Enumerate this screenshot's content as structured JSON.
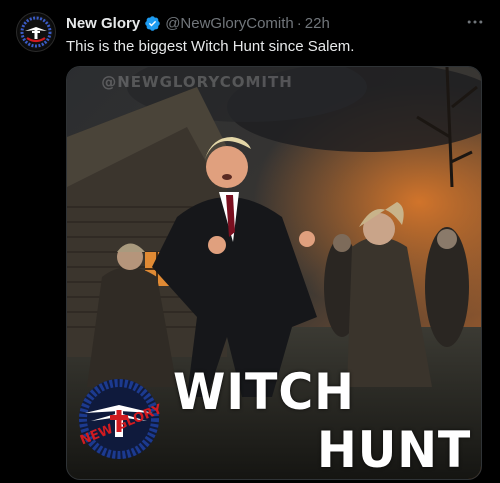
{
  "tweet": {
    "display_name": "New Glory",
    "handle": "@NewGloryComith",
    "separator": "·",
    "time": "22h",
    "text": "This is the biggest Witch Hunt since Salem.",
    "more_icon": "more-horizontal-icon",
    "verified_icon": "verified-badge-icon"
  },
  "media": {
    "watermark": "@NEWGLORYCOMITH",
    "title_line1": "WITCH",
    "title_line2": "HUNT",
    "logo_text": "NEW GLORY"
  },
  "colors": {
    "verified": "#1d9bf0",
    "text": "#e7e9ea",
    "muted": "#71767b",
    "logo_red": "#d11b20",
    "logo_blue": "#1c3a8f"
  }
}
